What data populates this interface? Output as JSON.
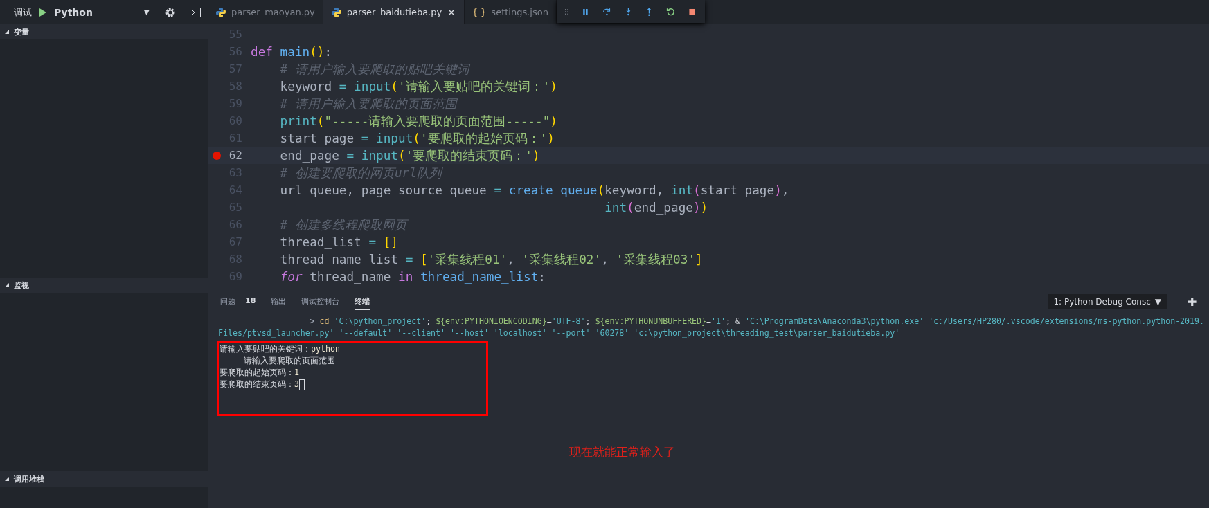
{
  "debug_bar": {
    "label": "调试",
    "configuration": "Python",
    "dropdown": "▼"
  },
  "sidebar": {
    "sections": [
      {
        "title": "变量",
        "expanded": true
      },
      {
        "title": "监视",
        "expanded": true
      },
      {
        "title": "调用堆栈",
        "expanded": true
      }
    ]
  },
  "tabs": [
    {
      "label": "parser_maoyan.py",
      "kind": "python",
      "selected": false
    },
    {
      "label": "parser_baidutieba.py",
      "kind": "python",
      "selected": true,
      "close": "×"
    },
    {
      "label": "settings.json",
      "kind": "json",
      "icon_text": "{ }",
      "selected": false
    }
  ],
  "debug_toolbar": {
    "buttons": [
      {
        "kind": "pause"
      },
      {
        "kind": "step-over"
      },
      {
        "kind": "step-into"
      },
      {
        "kind": "step-out"
      },
      {
        "kind": "restart"
      },
      {
        "kind": "stop"
      }
    ]
  },
  "editor": {
    "lines": [
      {
        "number": "55",
        "breakpoint": false,
        "highlighted": false
      },
      {
        "number": "56",
        "breakpoint": false,
        "highlighted": false,
        "tokens": [
          {
            "kind": "kw",
            "text": "def "
          },
          {
            "kind": "fn",
            "text": "main"
          },
          {
            "kind": "p1",
            "text": "()"
          },
          {
            "kind": "txt",
            "text": ":"
          }
        ]
      },
      {
        "number": "57",
        "breakpoint": false,
        "highlighted": false,
        "tokens": [
          {
            "kind": "cmt",
            "text": "    # 请用户输入要爬取的贴吧关键词"
          }
        ]
      },
      {
        "number": "58",
        "breakpoint": false,
        "highlighted": false,
        "tokens": [
          {
            "kind": "txt",
            "text": "    keyword "
          },
          {
            "kind": "op",
            "text": "= "
          },
          {
            "kind": "bi",
            "text": "input"
          },
          {
            "kind": "p1",
            "text": "("
          },
          {
            "kind": "str",
            "text": "'请输入要贴吧的关键词：'"
          },
          {
            "kind": "p1",
            "text": ")"
          }
        ]
      },
      {
        "number": "59",
        "breakpoint": false,
        "highlighted": false,
        "tokens": [
          {
            "kind": "cmt",
            "text": "    # 请用户输入要爬取的页面范围"
          }
        ]
      },
      {
        "number": "60",
        "breakpoint": false,
        "highlighted": false,
        "tokens": [
          {
            "kind": "bi",
            "text": "    print"
          },
          {
            "kind": "p1",
            "text": "("
          },
          {
            "kind": "str",
            "text": "\"-----请输入要爬取的页面范围-----\""
          },
          {
            "kind": "p1",
            "text": ")"
          }
        ]
      },
      {
        "number": "61",
        "breakpoint": false,
        "highlighted": false,
        "tokens": [
          {
            "kind": "txt",
            "text": "    start_page "
          },
          {
            "kind": "op",
            "text": "= "
          },
          {
            "kind": "bi",
            "text": "input"
          },
          {
            "kind": "p1",
            "text": "("
          },
          {
            "kind": "str",
            "text": "'要爬取的起始页码：'"
          },
          {
            "kind": "p1",
            "text": ")"
          }
        ]
      },
      {
        "number": "62",
        "breakpoint": true,
        "highlighted": true,
        "tokens": [
          {
            "kind": "txt",
            "text": "    end_page "
          },
          {
            "kind": "op",
            "text": "= "
          },
          {
            "kind": "bi",
            "text": "input"
          },
          {
            "kind": "p1",
            "text": "("
          },
          {
            "kind": "str",
            "text": "'要爬取的结束页码：'"
          },
          {
            "kind": "p1",
            "text": ")"
          }
        ]
      },
      {
        "number": "63",
        "breakpoint": false,
        "highlighted": false,
        "tokens": [
          {
            "kind": "cmt",
            "text": "    # 创建要爬取的网页url队列"
          }
        ]
      },
      {
        "number": "64",
        "breakpoint": false,
        "highlighted": false,
        "tokens": [
          {
            "kind": "txt",
            "text": "    url_queue, page_source_queue "
          },
          {
            "kind": "op",
            "text": "= "
          },
          {
            "kind": "fn",
            "text": "create_queue"
          },
          {
            "kind": "p1",
            "text": "("
          },
          {
            "kind": "txt",
            "text": "keyword, "
          },
          {
            "kind": "bi",
            "text": "int"
          },
          {
            "kind": "p2",
            "text": "("
          },
          {
            "kind": "txt",
            "text": "start_page"
          },
          {
            "kind": "p2",
            "text": ")"
          },
          {
            "kind": "txt",
            "text": ","
          }
        ]
      },
      {
        "number": "65",
        "breakpoint": false,
        "highlighted": false,
        "tokens": [
          {
            "kind": "bi",
            "text": "                                                int"
          },
          {
            "kind": "p2",
            "text": "("
          },
          {
            "kind": "txt",
            "text": "end_page"
          },
          {
            "kind": "p2",
            "text": ")"
          },
          {
            "kind": "p1",
            "text": ")"
          }
        ]
      },
      {
        "number": "66",
        "breakpoint": false,
        "highlighted": false,
        "tokens": [
          {
            "kind": "cmt",
            "text": "    # 创建多线程爬取网页"
          }
        ]
      },
      {
        "number": "67",
        "breakpoint": false,
        "highlighted": false,
        "tokens": [
          {
            "kind": "txt",
            "text": "    thread_list "
          },
          {
            "kind": "op",
            "text": "= "
          },
          {
            "kind": "p1",
            "text": "[]"
          }
        ]
      },
      {
        "number": "68",
        "breakpoint": false,
        "highlighted": false,
        "tokens": [
          {
            "kind": "txt",
            "text": "    thread_name_list "
          },
          {
            "kind": "op",
            "text": "= "
          },
          {
            "kind": "p1",
            "text": "["
          },
          {
            "kind": "str",
            "text": "'采集线程01'"
          },
          {
            "kind": "txt",
            "text": ", "
          },
          {
            "kind": "str",
            "text": "'采集线程02'"
          },
          {
            "kind": "txt",
            "text": ", "
          },
          {
            "kind": "str",
            "text": "'采集线程03'"
          },
          {
            "kind": "p1",
            "text": "]"
          }
        ]
      },
      {
        "number": "69",
        "breakpoint": false,
        "highlighted": false,
        "tokens": [
          {
            "kind": "kwi",
            "text": "    for"
          },
          {
            "kind": "txt",
            "text": " thread_name "
          },
          {
            "kind": "kw",
            "text": "in "
          },
          {
            "kind": "link",
            "text": "thread_name_list"
          },
          {
            "kind": "txt",
            "text": ":"
          }
        ]
      }
    ]
  },
  "panel": {
    "tabs": [
      {
        "label": "问题",
        "badge": "18",
        "selected": false
      },
      {
        "label": "输出",
        "selected": false
      },
      {
        "label": "调试控制台",
        "selected": false
      },
      {
        "label": "终端",
        "selected": true
      }
    ],
    "terminal_selector": "1: Python Debug Consc",
    "selector_caret": "▼",
    "add": "✚",
    "terminal_lines": [
      {
        "tokens": [
          {
            "kind": "prompt",
            "text": "                   > "
          },
          {
            "kind": "cmd",
            "text": "cd "
          },
          {
            "kind": "str",
            "text": "'C:\\python_project'"
          },
          {
            "kind": "out",
            "text": "; "
          },
          {
            "kind": "env",
            "text": "${env:PYTHONIOENCODING}"
          },
          {
            "kind": "out",
            "text": "="
          },
          {
            "kind": "str",
            "text": "'UTF-8'"
          },
          {
            "kind": "out",
            "text": "; "
          },
          {
            "kind": "env",
            "text": "${env:PYTHONUNBUFFERED}"
          },
          {
            "kind": "out",
            "text": "="
          },
          {
            "kind": "str",
            "text": "'1'"
          },
          {
            "kind": "out",
            "text": "; & "
          },
          {
            "kind": "str",
            "text": "'C:\\ProgramData\\Anaconda3\\python.exe' 'c:/Users/HP280/.vscode/extensions/ms-python.python-2019."
          }
        ]
      },
      {
        "tokens": [
          {
            "kind": "str",
            "text": "Files/ptvsd_launcher.py' '--default' '--client' '--host' 'localhost' '--port' '60278' 'c:\\python_project\\threading_test\\parser_baidutieba.py'"
          }
        ]
      },
      {
        "tokens": [
          {
            "kind": "out",
            "text": "请输入要贴吧的关键词："
          },
          {
            "kind": "input",
            "text": "python"
          }
        ]
      },
      {
        "tokens": [
          {
            "kind": "out",
            "text": "-----请输入要爬取的页面范围-----"
          }
        ]
      },
      {
        "tokens": [
          {
            "kind": "out",
            "text": "要爬取的起始页码："
          },
          {
            "kind": "input",
            "text": "1"
          }
        ]
      },
      {
        "tokens": [
          {
            "kind": "out",
            "text": "要爬取的结束页码："
          },
          {
            "kind": "input",
            "text": "3"
          }
        ],
        "cursor": true
      }
    ],
    "annotation": "现在就能正常输入了"
  }
}
